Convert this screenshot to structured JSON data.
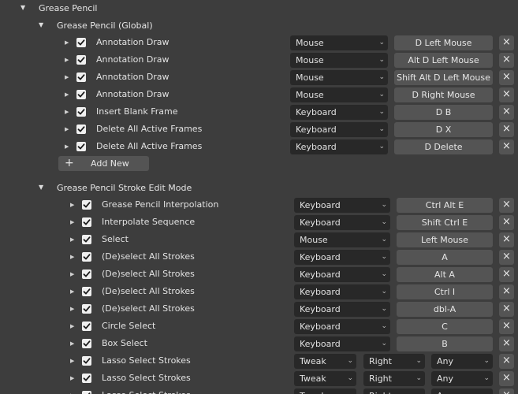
{
  "top_section": {
    "label": "Grease Pencil"
  },
  "global_section": {
    "label": "Grease Pencil (Global)",
    "rows": [
      {
        "name": "Annotation Draw",
        "type": "Mouse",
        "key": "D Left Mouse"
      },
      {
        "name": "Annotation Draw",
        "type": "Mouse",
        "key": "Alt D Left Mouse"
      },
      {
        "name": "Annotation Draw",
        "type": "Mouse",
        "key": "Shift Alt D Left Mouse"
      },
      {
        "name": "Annotation Draw",
        "type": "Mouse",
        "key": "D Right Mouse"
      },
      {
        "name": "Insert Blank Frame",
        "type": "Keyboard",
        "key": "D B"
      },
      {
        "name": "Delete All Active Frames",
        "type": "Keyboard",
        "key": "D X"
      },
      {
        "name": "Delete All Active Frames",
        "type": "Keyboard",
        "key": "D Delete"
      }
    ],
    "add_new_label": "Add New"
  },
  "stroke_section": {
    "label": "Grease Pencil Stroke Edit Mode",
    "rows": [
      {
        "name": "Grease Pencil Interpolation",
        "type": "Keyboard",
        "key": "Ctrl Alt E"
      },
      {
        "name": "Interpolate Sequence",
        "type": "Keyboard",
        "key": "Shift Ctrl E"
      },
      {
        "name": "Select",
        "type": "Mouse",
        "key": "Left Mouse"
      },
      {
        "name": "(De)select All Strokes",
        "type": "Keyboard",
        "key": "A"
      },
      {
        "name": "(De)select All Strokes",
        "type": "Keyboard",
        "key": "Alt A"
      },
      {
        "name": "(De)select All Strokes",
        "type": "Keyboard",
        "key": "Ctrl I"
      },
      {
        "name": "(De)select All Strokes",
        "type": "Keyboard",
        "key": "dbl-A"
      },
      {
        "name": "Circle Select",
        "type": "Keyboard",
        "key": "C"
      },
      {
        "name": "Box Select",
        "type": "Keyboard",
        "key": "B"
      }
    ],
    "tweak_rows": [
      {
        "name": "Lasso Select Strokes",
        "type": "Tweak",
        "direction": "Right",
        "modifier": "Any"
      },
      {
        "name": "Lasso Select Strokes",
        "type": "Tweak",
        "direction": "Right",
        "modifier": "Any"
      },
      {
        "name": "Lasso Select Strokes",
        "type": "Tweak",
        "direction": "Right",
        "modifier": "Any"
      }
    ]
  },
  "icons": {
    "expand": "triangle-right-icon",
    "collapse": "triangle-down-icon",
    "checkbox": "checkmark-icon",
    "remove": "close-x-icon",
    "add": "plus-icon",
    "dropdown": "chevron-down-icon"
  }
}
